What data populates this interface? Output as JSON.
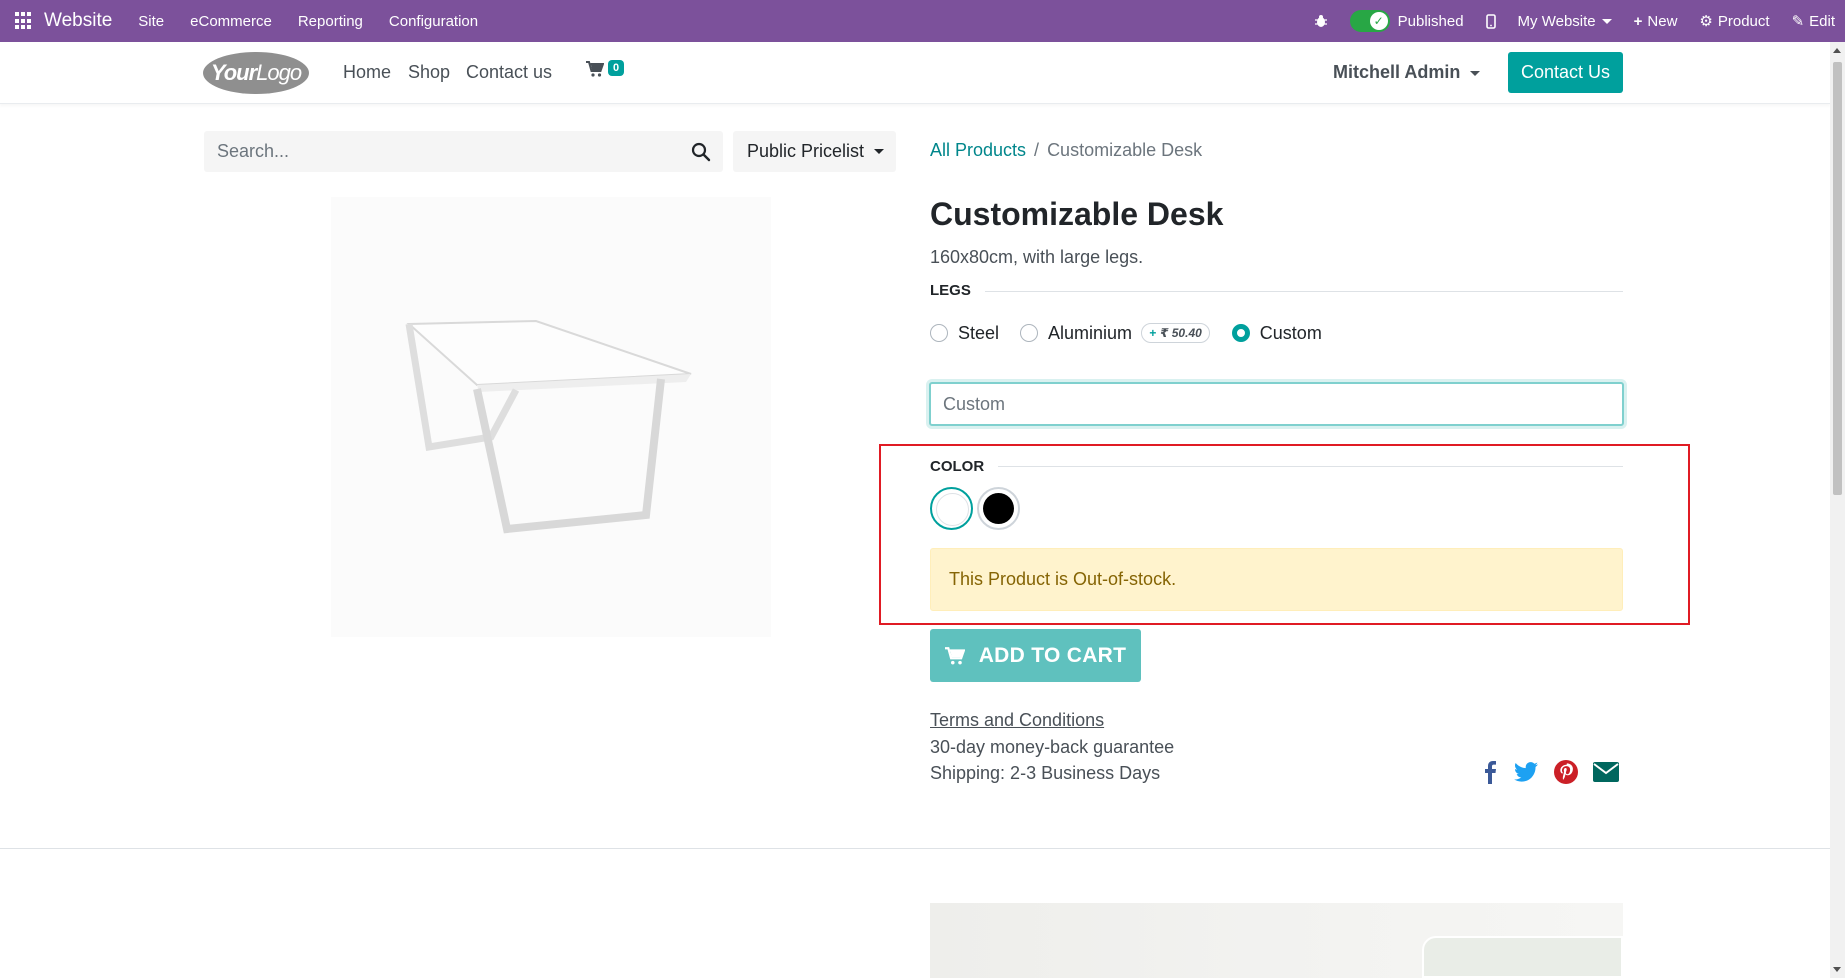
{
  "topbar": {
    "brand": "Website",
    "menus": [
      "Site",
      "eCommerce",
      "Reporting",
      "Configuration"
    ],
    "published_label": "Published",
    "website_label": "My Website",
    "new_label": "New",
    "product_label": "Product",
    "edit_label": "Edit",
    "bg_color": "#7c519b"
  },
  "header": {
    "logo_text_a": "Your",
    "logo_text_b": "Logo",
    "nav": [
      "Home",
      "Shop",
      "Contact us"
    ],
    "cart_count": "0",
    "user": "Mitchell Admin",
    "contact_button": "Contact Us",
    "accent_color": "#00a09d"
  },
  "search": {
    "placeholder": "Search..."
  },
  "pricelist": {
    "label": "Public Pricelist"
  },
  "breadcrumb": {
    "parent": "All Products",
    "separator": "/",
    "current": "Customizable Desk"
  },
  "product": {
    "name": "Customizable Desk",
    "description": "160x80cm, with large legs.",
    "legs_label": "LEGS",
    "legs_options": [
      {
        "label": "Steel",
        "selected": false,
        "extra": ""
      },
      {
        "label": "Aluminium",
        "selected": false,
        "extra_sign": "+",
        "extra": "₹ 50.40"
      },
      {
        "label": "Custom",
        "selected": true,
        "extra": ""
      }
    ],
    "custom_placeholder": "Custom",
    "color_label": "COLOR",
    "colors": [
      {
        "name": "White",
        "hex": "#ffffff",
        "selected": true
      },
      {
        "name": "Black",
        "hex": "#000000",
        "selected": false
      }
    ],
    "stock_alert": "This Product is Out-of-stock.",
    "add_to_cart": "ADD TO CART",
    "terms": "Terms and Conditions",
    "guarantee": "30-day money-back guarantee",
    "shipping": "Shipping: 2-3 Business Days"
  },
  "social": [
    "facebook-icon",
    "twitter-icon",
    "pinterest-icon",
    "email-icon"
  ]
}
